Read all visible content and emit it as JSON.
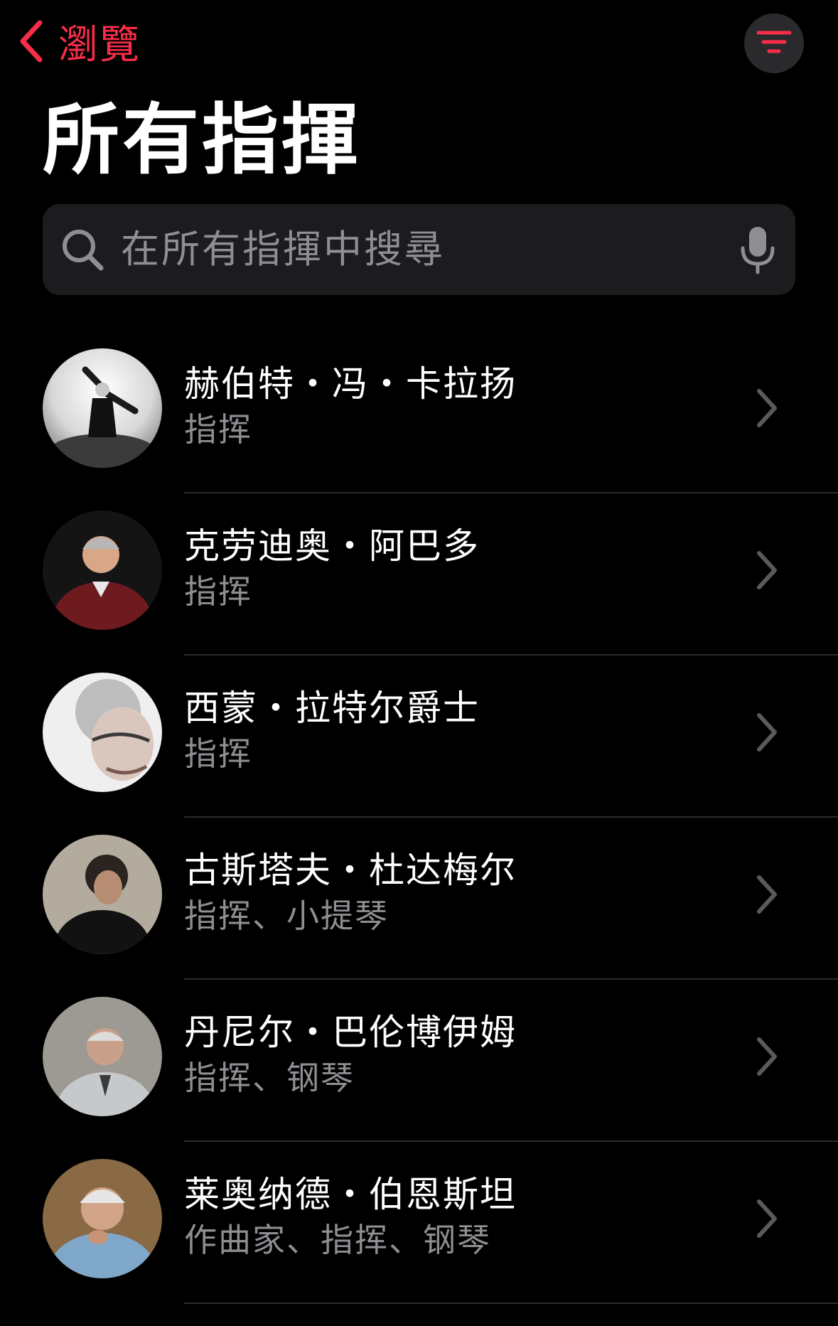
{
  "nav": {
    "back_label": "瀏覽",
    "accent_color": "#fa2d48"
  },
  "page": {
    "title": "所有指揮"
  },
  "search": {
    "placeholder": "在所有指揮中搜尋"
  },
  "conductors": [
    {
      "name": "赫伯特・冯・卡拉扬",
      "roles": "指挥"
    },
    {
      "name": "克劳迪奥・阿巴多",
      "roles": "指挥"
    },
    {
      "name": "西蒙・拉特尔爵士",
      "roles": "指挥"
    },
    {
      "name": "古斯塔夫・杜达梅尔",
      "roles": "指挥、小提琴"
    },
    {
      "name": "丹尼尔・巴伦博伊姆",
      "roles": "指挥、钢琴"
    },
    {
      "name": "莱奥纳德・伯恩斯坦",
      "roles": "作曲家、指挥、钢琴"
    }
  ],
  "icons": {
    "back": "chevron-left-icon",
    "filter": "filter-icon",
    "search": "search-icon",
    "mic": "microphone-icon",
    "row_chevron": "chevron-right-icon"
  }
}
